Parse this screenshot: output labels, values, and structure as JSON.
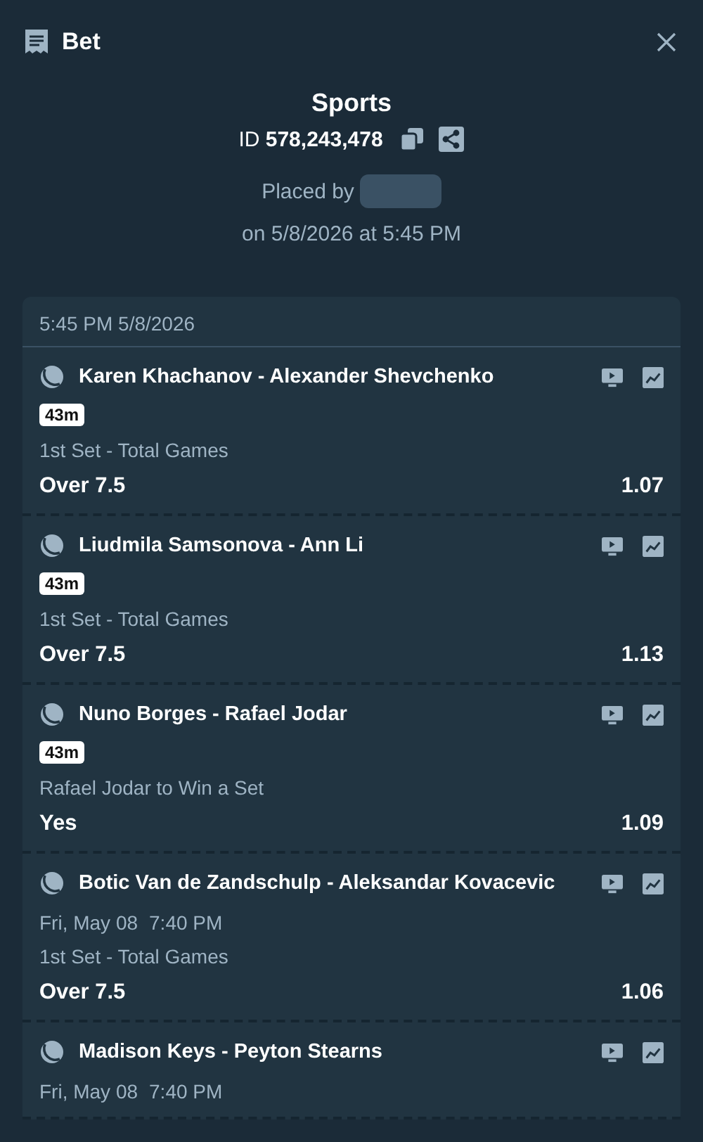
{
  "header": {
    "title": "Bet"
  },
  "summary": {
    "title": "Sports",
    "id_label": "ID",
    "id_value": "578,243,478",
    "placed_by": "Placed by",
    "placed_on": "on 5/8/2026 at 5:45 PM"
  },
  "slip": {
    "timestamp": "5:45 PM 5/8/2026",
    "selections": [
      {
        "kind": "live",
        "event": "Karen Khachanov - Alexander Shevchenko",
        "badge": "43m",
        "market": "1st Set - Total Games",
        "pick": "Over 7.5",
        "odds": "1.07"
      },
      {
        "kind": "live",
        "event": "Liudmila Samsonova - Ann Li",
        "badge": "43m",
        "market": "1st Set - Total Games",
        "pick": "Over 7.5",
        "odds": "1.13"
      },
      {
        "kind": "live",
        "event": "Nuno Borges - Rafael Jodar",
        "badge": "43m",
        "market": "Rafael Jodar to Win a Set",
        "pick": "Yes",
        "odds": "1.09"
      },
      {
        "kind": "scheduled",
        "event": "Botic Van de Zandschulp - Aleksandar Kovacevic",
        "date": "Fri, May 08",
        "time": "7:40 PM",
        "market": "1st Set - Total Games",
        "pick": "Over 7.5",
        "odds": "1.06"
      },
      {
        "kind": "scheduled",
        "event": "Madison Keys - Peyton Stearns",
        "date": "Fri, May 08",
        "time": "7:40 PM"
      }
    ]
  }
}
